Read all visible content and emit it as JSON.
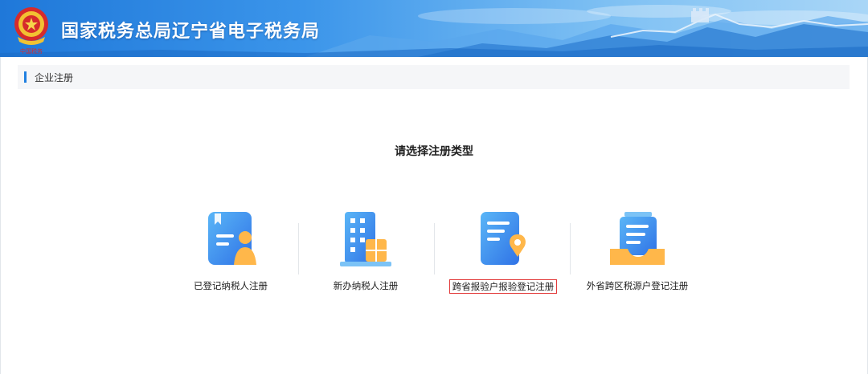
{
  "header": {
    "title": "国家税务总局辽宁省电子税务局",
    "emblem_icon": "tax-emblem-icon",
    "brand_color": "#1f78d9"
  },
  "breadcrumb": {
    "label": "企业注册"
  },
  "main": {
    "prompt": "请选择注册类型",
    "options": [
      {
        "label": "已登记纳税人注册",
        "icon": "registered-taxpayer-icon",
        "highlighted": false
      },
      {
        "label": "新办纳税人注册",
        "icon": "building-icon",
        "highlighted": false
      },
      {
        "label": "跨省报验户报验登记注册",
        "icon": "document-location-icon",
        "highlighted": true
      },
      {
        "label": "外省跨区税源户登记注册",
        "icon": "inbox-document-icon",
        "highlighted": false
      }
    ]
  },
  "colors": {
    "accent_blue": "#3a86f2",
    "accent_orange": "#ffb74a",
    "highlight_border": "#e23a3a"
  }
}
